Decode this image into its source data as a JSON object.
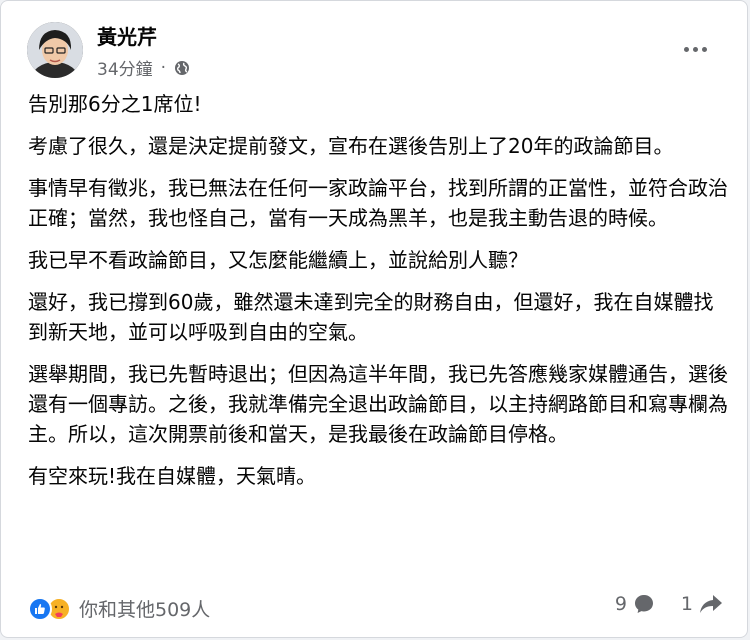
{
  "post": {
    "author": "黃光芹",
    "time": "34分鐘",
    "dot": "·",
    "paragraphs": [
      "告別那6分之1席位!",
      "考慮了很久，還是決定提前發文，宣布在選後告別上了20年的政論節目。",
      "事情早有徵兆，我已無法在任何一家政論平台，找到所謂的正當性，並符合政治正確；當然，我也怪自己，當有一天成為黑羊，也是我主動告退的時候。",
      "我已早不看政論節目，又怎麼能繼續上，並說給別人聽？",
      "還好，我已撐到60歲，雖然還未達到完全的財務自由，但還好，我在自媒體找到新天地，並可以呼吸到自由的空氣。",
      "選舉期間，我已先暫時退出；但因為這半年間，我已先答應幾家媒體通告，選後還有一個專訪。之後，我就準備完全退出政論節目，以主持網路節目和寫專欄為主。所以，這次開票前後和當天，是我最後在政論節目停格。",
      "有空來玩!我在自媒體，天氣晴。"
    ]
  },
  "footer": {
    "reactions_text": "你和其他509人",
    "comments_count": "9",
    "shares_count": "1"
  },
  "icons": {
    "privacy": "globe-icon",
    "more": "more-options-icon",
    "like": "like-reaction-icon",
    "care": "care-reaction-icon",
    "comment": "comment-icon",
    "share": "share-icon"
  },
  "colors": {
    "like_blue": "#1877f2",
    "secondary_text": "#65676b",
    "care_yellow": "#f7b125"
  }
}
